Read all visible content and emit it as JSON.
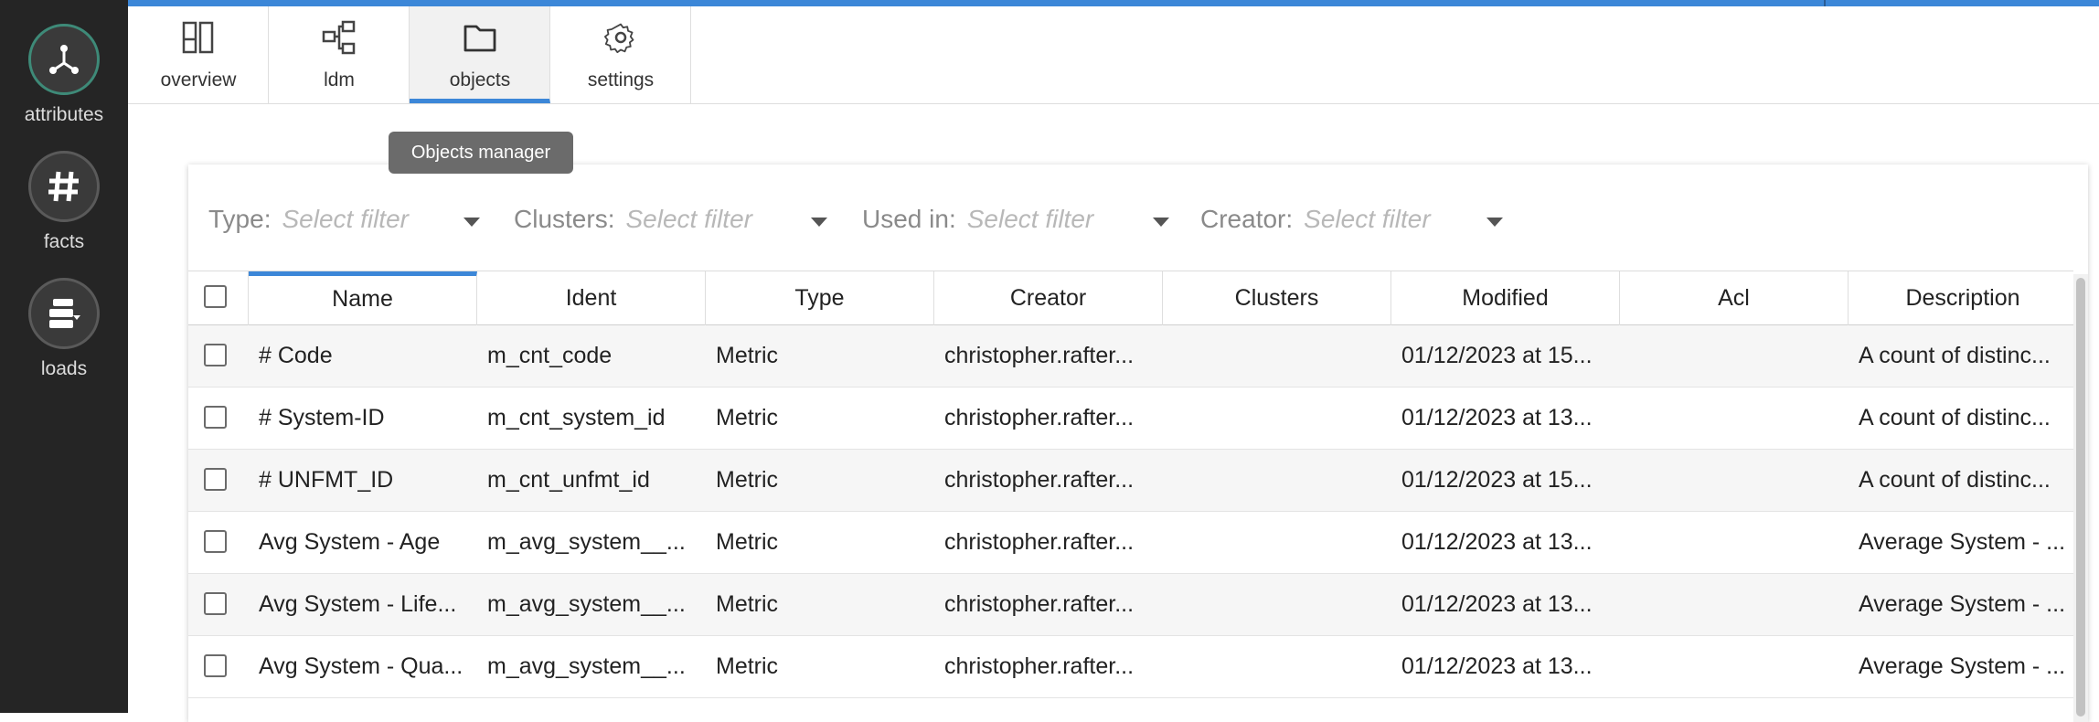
{
  "sidebar": {
    "items": [
      {
        "label": "attributes",
        "icon": "attributes-hub-icon"
      },
      {
        "label": "facts",
        "icon": "hash-icon"
      },
      {
        "label": "loads",
        "icon": "server-load-icon"
      }
    ]
  },
  "tabs": [
    {
      "label": "overview",
      "icon": "overview-icon"
    },
    {
      "label": "ldm",
      "icon": "ldm-diagram-icon"
    },
    {
      "label": "objects",
      "icon": "folder-icon",
      "active": true
    },
    {
      "label": "settings",
      "icon": "gear-icon"
    }
  ],
  "tooltip": "Objects manager",
  "filters": [
    {
      "label": "Type:",
      "placeholder": "Select filter"
    },
    {
      "label": "Clusters:",
      "placeholder": "Select filter"
    },
    {
      "label": "Used in:",
      "placeholder": "Select filter"
    },
    {
      "label": "Creator:",
      "placeholder": "Select filter"
    }
  ],
  "table": {
    "columns": [
      "Name",
      "Ident",
      "Type",
      "Creator",
      "Clusters",
      "Modified",
      "Acl",
      "Description"
    ],
    "sorted_column": "Name",
    "rows": [
      [
        "# Code",
        "m_cnt_code",
        "Metric",
        "christopher.rafter...",
        "",
        "01/12/2023 at 15...",
        "",
        "A count of distinc..."
      ],
      [
        "# System-ID",
        "m_cnt_system_id",
        "Metric",
        "christopher.rafter...",
        "",
        "01/12/2023 at 13...",
        "",
        "A count of distinc..."
      ],
      [
        "# UNFMT_ID",
        "m_cnt_unfmt_id",
        "Metric",
        "christopher.rafter...",
        "",
        "01/12/2023 at 15...",
        "",
        "A count of distinc..."
      ],
      [
        "Avg System - Age",
        "m_avg_system__...",
        "Metric",
        "christopher.rafter...",
        "",
        "01/12/2023 at 13...",
        "",
        "Average System - ..."
      ],
      [
        "Avg System - Life...",
        "m_avg_system__...",
        "Metric",
        "christopher.rafter...",
        "",
        "01/12/2023 at 13...",
        "",
        "Average System - ..."
      ],
      [
        "Avg System - Qua...",
        "m_avg_system__...",
        "Metric",
        "christopher.rafter...",
        "",
        "01/12/2023 at 13...",
        "",
        "Average System - ..."
      ]
    ]
  },
  "colors": {
    "accent": "#3c87d8",
    "sidebar_bg": "#252525",
    "active_ring": "#3e8a78"
  }
}
